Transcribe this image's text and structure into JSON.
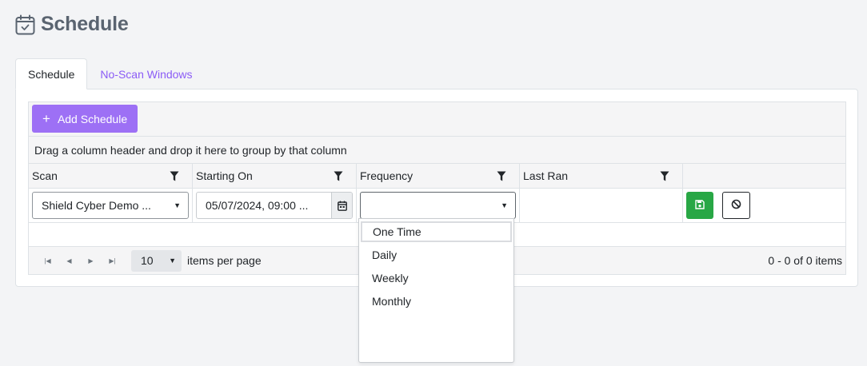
{
  "page": {
    "title": "Schedule"
  },
  "tabs": [
    {
      "label": "Schedule"
    },
    {
      "label": "No-Scan Windows"
    }
  ],
  "toolbar": {
    "add_label": "Add Schedule"
  },
  "grid": {
    "group_hint": "Drag a column header and drop it here to group by that column",
    "columns": [
      {
        "label": "Scan"
      },
      {
        "label": "Starting On"
      },
      {
        "label": "Frequency"
      },
      {
        "label": "Last Ran"
      }
    ],
    "edit_row": {
      "scan_value": "Shield Cyber Demo ...",
      "starting_on_value": "05/07/2024, 09:00 ...",
      "frequency_value": ""
    }
  },
  "pager": {
    "page_size": "10",
    "per_page_label": "items per page",
    "info": "0 - 0 of 0 items"
  },
  "frequency_options": [
    {
      "label": "One Time"
    },
    {
      "label": "Daily"
    },
    {
      "label": "Weekly"
    },
    {
      "label": "Monthly"
    }
  ],
  "colors": {
    "accent": "#9d70f5",
    "link": "#8b5cf6",
    "success": "#28a745"
  },
  "icons": {
    "header": "calendar-check-icon",
    "filter": "filter-icon",
    "save": "floppy-disk-icon",
    "cancel": "cancel-circle-icon",
    "calendar": "calendar-icon"
  }
}
